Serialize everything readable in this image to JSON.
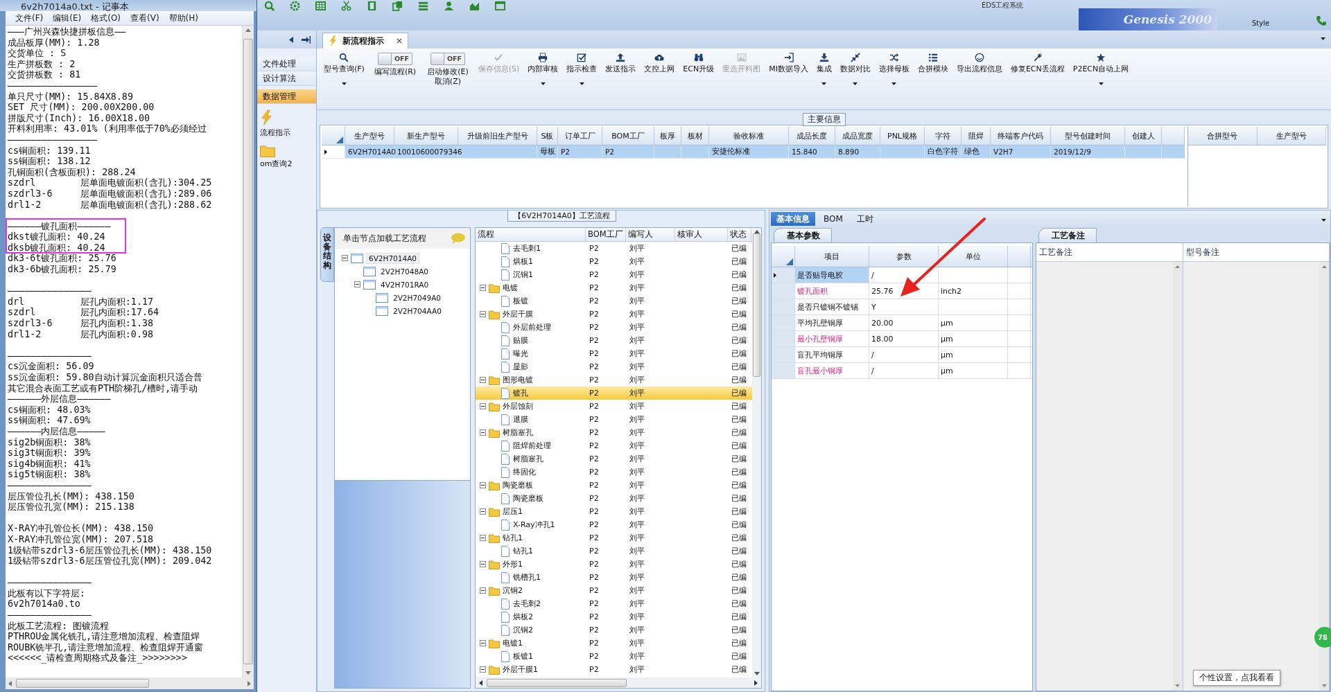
{
  "notepad": {
    "title": "6v2h7014a0.txt - 记事本",
    "menu": [
      "文件(F)",
      "编辑(E)",
      "格式(O)",
      "查看(V)",
      "帮助(H)"
    ],
    "lines": [
      {
        "text": "———广州兴森快捷拼板信息——"
      },
      {
        "text": "成品板厚(MM): 1.28"
      },
      {
        "text": "交货单位 : S"
      },
      {
        "text": "生产拼板数 : 2"
      },
      {
        "text": "交货拼板数 : 81"
      },
      {
        "text": "————————————————"
      },
      {
        "text": "单只尺寸(MM): 15.84X8.89"
      },
      {
        "text": "SET 尺寸(MM): 200.00X200.00"
      },
      {
        "text": "拼版尺寸(Inch): 16.00X18.00"
      },
      {
        "text": "开料利用率: 43.01% (利用率低于70%必须经过"
      },
      {
        "text": "————————————————"
      },
      {
        "text": "cs铜面积: 139.11"
      },
      {
        "text": "ss铜面积: 138.12"
      },
      {
        "text": "孔铜面积(含板面积): 288.24"
      },
      {
        "text": "szdrl        层单面电镀面积(含孔):304.25"
      },
      {
        "text": "szdrl3-6     层单面电镀面积(含孔):289.06"
      },
      {
        "text": "drl1-2       层单面电镀面积(含孔):288.62",
        "blank_after": true
      },
      {
        "text": "——————镀孔面积——————"
      },
      {
        "text": "dkst镀孔面积: 40.24"
      },
      {
        "text": "dksb镀孔面积: 40.24"
      },
      {
        "text": "dk3-6t镀孔面积: 25.76"
      },
      {
        "text": "dk3-6b镀孔面积: 25.79",
        "blank_after": true
      },
      {
        "text": "———————————————",
        "blank_before": true
      },
      {
        "text": "drl          层孔内面积:1.17"
      },
      {
        "text": "szdrl        层孔内面积:17.64"
      },
      {
        "text": "szdrl3-6     层孔内面积:1.38"
      },
      {
        "text": "drl1-2       层孔内面积:0.98",
        "blank_after": true
      },
      {
        "text": "———————————————"
      },
      {
        "text": "cs沉金面积: 56.09"
      },
      {
        "text": "ss沉金面积: 59.80自动计算沉金面积只适合普"
      },
      {
        "text": "其它混合表面工艺或有PTH阶梯孔/槽时,请手动"
      },
      {
        "text": "——————外层信息——————"
      },
      {
        "text": "cs铜面积: 48.03%"
      },
      {
        "text": "ss铜面积: 47.69%"
      },
      {
        "text": "——————内层信息—————"
      },
      {
        "text": "sig2b铜面积: 38%"
      },
      {
        "text": "sig3t铜面积: 39%"
      },
      {
        "text": "sig4b铜面积: 41%"
      },
      {
        "text": "sig5t铜面积: 38%"
      },
      {
        "text": "———————————————"
      },
      {
        "text": "层压管位孔长(MM): 438.150"
      },
      {
        "text": "层压管位孔宽(MM): 215.138",
        "blank_after": true
      },
      {
        "text": "X-RAY冲孔管位长(MM): 438.150"
      },
      {
        "text": "X-RAY冲孔管位宽(MM): 207.518"
      },
      {
        "text": "1级钻带szdrl3-6层压管位孔长(MM): 438.150"
      },
      {
        "text": "1级钻带szdrl3-6层压管位孔宽(MM): 209.042",
        "blank_after": true
      },
      {
        "text": "———————————————"
      },
      {
        "text": "此板有以下字符层:"
      },
      {
        "text": "6v2h7014a0.to"
      },
      {
        "text": "———————————————"
      },
      {
        "text": "此板工艺流程: 图镀流程"
      },
      {
        "text": "PTHROU金属化铣孔,请注意增加流程、检查阻焊"
      },
      {
        "text": "ROUBK铣半孔,请注意增加流程、检查阻焊开通窗"
      },
      {
        "text": "<<<<<<_请检查周期格式及备注_>>>>>>>>"
      }
    ]
  },
  "app": {
    "title": "EDS工程系统",
    "banner": "Genesis 2000",
    "style_label": "Style"
  },
  "sidebar": {
    "items": [
      {
        "label": "文件处理",
        "selected": false
      },
      {
        "label": "设计算法",
        "selected": false
      },
      {
        "label": "数据管理",
        "selected": true
      }
    ],
    "shortcuts": [
      {
        "label": "流程指示"
      },
      {
        "label": "om查询2"
      }
    ]
  },
  "document_tab": {
    "label": "新流程指示"
  },
  "ribbon": [
    {
      "kind": "button",
      "label": "型号查询(F)",
      "dropdown": true,
      "disabled": false
    },
    {
      "kind": "toggle",
      "label": "编写流程(R)",
      "switch_text": "OFF",
      "on": false
    },
    {
      "kind": "toggle",
      "label": "启动修改(E)",
      "sublabel": "取消(Z)",
      "switch_text": "OFF",
      "on": false
    },
    {
      "kind": "button",
      "label": "保存信息(S)",
      "dropdown": false,
      "disabled": true
    },
    {
      "kind": "button",
      "label": "内部审核",
      "dropdown": true,
      "disabled": false
    },
    {
      "kind": "button",
      "label": "指示检查",
      "dropdown": true,
      "disabled": false
    },
    {
      "kind": "button",
      "label": "发送指示",
      "dropdown": false,
      "disabled": false
    },
    {
      "kind": "button",
      "label": "文控上网",
      "dropdown": false,
      "disabled": false
    },
    {
      "kind": "button",
      "label": "ECN升级",
      "dropdown": false,
      "disabled": false
    },
    {
      "kind": "button",
      "label": "重选开料图",
      "dropdown": false,
      "disabled": true
    },
    {
      "kind": "button",
      "label": "MI数据导入",
      "dropdown": false,
      "disabled": false
    },
    {
      "kind": "button",
      "label": "集成",
      "dropdown": true,
      "disabled": false
    },
    {
      "kind": "button",
      "label": "数据对比",
      "dropdown": true,
      "disabled": false
    },
    {
      "kind": "button",
      "label": "选择母板",
      "dropdown": true,
      "disabled": false
    },
    {
      "kind": "button",
      "label": "合拼模块",
      "dropdown": false,
      "disabled": false
    },
    {
      "kind": "button",
      "label": "导出流程信息",
      "dropdown": false,
      "disabled": false
    },
    {
      "kind": "button",
      "label": "修复ECN丢流程",
      "dropdown": false,
      "disabled": false
    },
    {
      "kind": "button",
      "label": "P2ECN自动上网",
      "dropdown": true,
      "disabled": false
    }
  ],
  "main_info": {
    "title": "主要信息",
    "columns": [
      "生产型号",
      "新生产型号",
      "升级前旧生产型号",
      "S板",
      "订单工厂",
      "BOM工厂",
      "板厚",
      "板材",
      "验收标准",
      "成品长度",
      "成品宽度",
      "PNL规格",
      "字符",
      "阻焊",
      "终端客户代码",
      "型号创建时间",
      "创建人"
    ],
    "rows": [
      {
        "selected": true,
        "cells": [
          "6V2H7014A0",
          "10010600079346",
          null,
          "母板",
          "P2",
          "P2",
          null,
          null,
          "安捷伦标准",
          "15.840",
          "8.890",
          null,
          "白色字符",
          "绿色",
          "V2H7",
          "2019/12/9",
          null
        ]
      }
    ],
    "side_columns": [
      "合拼型号",
      "生产型号"
    ]
  },
  "process": {
    "title": "【6V2H7014A0】工艺流程",
    "side_tab": "设备结构",
    "tree_header": "单击节点加载工艺流程",
    "tree": [
      {
        "label": "6V2H7014A0",
        "selected": true,
        "expanded": true,
        "children": [
          {
            "label": "2V2H7048A0",
            "selected": false
          },
          {
            "label": "4V2H701RA0",
            "selected": false,
            "expanded": true,
            "children": [
              {
                "label": "2V2H7049A0",
                "selected": false
              },
              {
                "label": "2V2H704AA0",
                "selected": false
              }
            ]
          }
        ]
      }
    ],
    "columns": [
      "流程",
      "BOM工厂",
      "编写人",
      "核审人",
      "状态"
    ],
    "rows": [
      {
        "kind": "continued",
        "children": [
          {
            "kind": "step",
            "name": "去毛刺1",
            "bom": "P2",
            "writer": "刘平",
            "status": "已编",
            "selected": false
          },
          {
            "kind": "step",
            "name": "烘板1",
            "bom": "P2",
            "writer": "刘平",
            "status": "已编",
            "selected": false
          },
          {
            "kind": "step",
            "name": "沉铜1",
            "bom": "P2",
            "writer": "刘平",
            "status": "已编",
            "selected": false
          }
        ]
      },
      {
        "kind": "folder",
        "name": "电镀",
        "bom": "P2",
        "writer": "刘平",
        "status": "已编",
        "selected": false,
        "expanded": true,
        "children": [
          {
            "kind": "step",
            "name": "板镀",
            "bom": "P2",
            "writer": "刘平",
            "status": "已编",
            "selected": false
          }
        ]
      },
      {
        "kind": "folder",
        "name": "外层干膜",
        "bom": "P2",
        "writer": "刘平",
        "status": "已编",
        "selected": false,
        "expanded": true,
        "children": [
          {
            "kind": "step",
            "name": "外层前处理",
            "bom": "P2",
            "writer": "刘平",
            "status": "已编",
            "selected": false
          },
          {
            "kind": "step",
            "name": "贴膜",
            "bom": "P2",
            "writer": "刘平",
            "status": "已编",
            "selected": false
          },
          {
            "kind": "step",
            "name": "曝光",
            "bom": "P2",
            "writer": "刘平",
            "status": "已编",
            "selected": false
          },
          {
            "kind": "step",
            "name": "显影",
            "bom": "P2",
            "writer": "刘平",
            "status": "已编",
            "selected": false
          }
        ]
      },
      {
        "kind": "folder",
        "name": "图形电镀",
        "bom": "P2",
        "writer": "刘平",
        "status": "已编",
        "selected": false,
        "expanded": true,
        "children": [
          {
            "kind": "step",
            "name": "镀孔",
            "bom": "P2",
            "writer": "刘平",
            "status": "已编",
            "selected": true
          }
        ]
      },
      {
        "kind": "folder",
        "name": "外层蚀刻",
        "bom": "P2",
        "writer": "刘平",
        "status": "已编",
        "selected": false,
        "expanded": true,
        "children": [
          {
            "kind": "step",
            "name": "退膜",
            "bom": "P2",
            "writer": "刘平",
            "status": "已编",
            "selected": false
          }
        ]
      },
      {
        "kind": "folder",
        "name": "树脂塞孔",
        "bom": "P2",
        "writer": "刘平",
        "status": "已编",
        "selected": false,
        "expanded": true,
        "children": [
          {
            "kind": "step",
            "name": "阻焊前处理",
            "bom": "P2",
            "writer": "刘平",
            "status": "已编",
            "selected": false
          },
          {
            "kind": "step",
            "name": "树脂塞孔",
            "bom": "P2",
            "writer": "刘平",
            "status": "已编",
            "selected": false
          },
          {
            "kind": "step",
            "name": "终固化",
            "bom": "P2",
            "writer": "刘平",
            "status": "已编",
            "selected": false
          }
        ]
      },
      {
        "kind": "folder",
        "name": "陶瓷磨板",
        "bom": "P2",
        "writer": "刘平",
        "status": "已编",
        "selected": false,
        "expanded": true,
        "children": [
          {
            "kind": "step",
            "name": "陶瓷磨板",
            "bom": "P2",
            "writer": "刘平",
            "status": "已编",
            "selected": false
          }
        ]
      },
      {
        "kind": "folder",
        "name": "层压1",
        "bom": "P2",
        "writer": "刘平",
        "status": "已编",
        "selected": false,
        "expanded": true,
        "children": [
          {
            "kind": "step",
            "name": "X-Ray冲孔1",
            "bom": "P2",
            "writer": "刘平",
            "status": "已编",
            "selected": false
          }
        ]
      },
      {
        "kind": "folder",
        "name": "钻孔1",
        "bom": "P2",
        "writer": "刘平",
        "status": "已编",
        "selected": false,
        "expanded": true,
        "children": [
          {
            "kind": "step",
            "name": "钻孔1",
            "bom": "P2",
            "writer": "刘平",
            "status": "已编",
            "selected": false
          }
        ]
      },
      {
        "kind": "folder",
        "name": "外形1",
        "bom": "P2",
        "writer": "刘平",
        "status": "已编",
        "selected": false,
        "expanded": true,
        "children": [
          {
            "kind": "step",
            "name": "铣槽孔1",
            "bom": "P2",
            "writer": "刘平",
            "status": "已编",
            "selected": false
          }
        ]
      },
      {
        "kind": "folder",
        "name": "沉铜2",
        "bom": "P2",
        "writer": "刘平",
        "status": "已编",
        "selected": false,
        "expanded": true,
        "children": [
          {
            "kind": "step",
            "name": "去毛刺2",
            "bom": "P2",
            "writer": "刘平",
            "status": "已编",
            "selected": false
          },
          {
            "kind": "step",
            "name": "烘板2",
            "bom": "P2",
            "writer": "刘平",
            "status": "已编",
            "selected": false
          },
          {
            "kind": "step",
            "name": "沉铜2",
            "bom": "P2",
            "writer": "刘平",
            "status": "已编",
            "selected": false
          }
        ]
      },
      {
        "kind": "folder",
        "name": "电镀1",
        "bom": "P2",
        "writer": "刘平",
        "status": "已编",
        "selected": false,
        "expanded": true,
        "children": [
          {
            "kind": "step",
            "name": "板镀1",
            "bom": "P2",
            "writer": "刘平",
            "status": "已编",
            "selected": false
          }
        ]
      },
      {
        "kind": "folder",
        "name": "外层干膜1",
        "bom": "P2",
        "writer": "刘平",
        "status": "已编",
        "selected": false,
        "expanded": true
      }
    ]
  },
  "details": {
    "tabs": [
      {
        "label": "基本信息",
        "selected": true
      },
      {
        "label": "BOM",
        "selected": false
      },
      {
        "label": "工时",
        "selected": false
      }
    ],
    "params": {
      "tab": "基本参数",
      "columns": [
        "项目",
        "参数",
        "单位"
      ],
      "rows": [
        {
          "item": "是否贴导电胶",
          "value": "/",
          "selected": true,
          "highlighted": false
        },
        {
          "item": "镀孔面积",
          "value": "25.76",
          "unit": "inch2",
          "selected": false,
          "highlighted": true
        },
        {
          "item": "是否只镀铜不镀锡",
          "value": "Y",
          "selected": false,
          "highlighted": false
        },
        {
          "item": "平均孔壁铜厚",
          "value": "20.00",
          "unit": "μm",
          "selected": false,
          "highlighted": false
        },
        {
          "item": "最小孔壁铜厚",
          "value": "18.00",
          "unit": "μm",
          "selected": false,
          "highlighted": true
        },
        {
          "item": "盲孔平均铜厚",
          "value": "/",
          "unit": "μm",
          "selected": false,
          "highlighted": false
        },
        {
          "item": "盲孔最小铜厚",
          "value": "/",
          "unit": "μm",
          "selected": false,
          "highlighted": true
        }
      ]
    },
    "notes": {
      "tab": "工艺备注",
      "columns": [
        "工艺备注",
        "型号备注"
      ]
    }
  },
  "tooltip": "个性设置，点我看看",
  "badge": "78"
}
